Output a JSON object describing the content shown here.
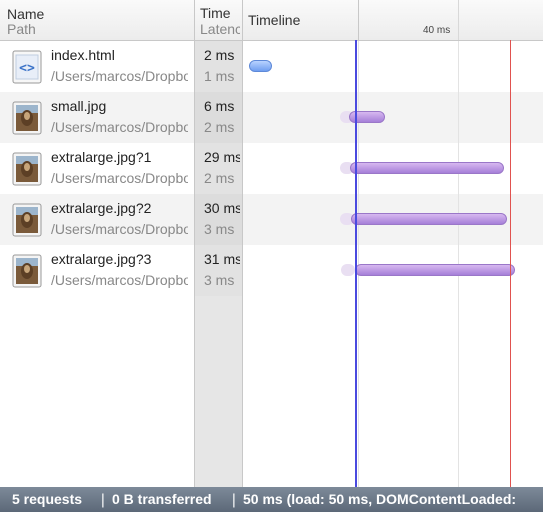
{
  "header": {
    "name_label": "Name",
    "path_label": "Path",
    "time_label": "Time",
    "latency_label": "Latency",
    "timeline_label": "Timeline",
    "tick_label": "40 ms"
  },
  "rows": [
    {
      "name": "index.html",
      "path": "/Users/marcos/Dropbox",
      "time": "2 ms",
      "latency": "1 ms",
      "icon": "html-file-icon"
    },
    {
      "name": "small.jpg",
      "path": "/Users/marcos/Dropbox",
      "time": "6 ms",
      "latency": "2 ms",
      "icon": "image-file-icon"
    },
    {
      "name": "extralarge.jpg?1",
      "path": "/Users/marcos/Dropbox",
      "time": "29 ms",
      "latency": "2 ms",
      "icon": "image-file-icon"
    },
    {
      "name": "extralarge.jpg?2",
      "path": "/Users/marcos/Dropbox",
      "time": "30 ms",
      "latency": "3 ms",
      "icon": "image-file-icon"
    },
    {
      "name": "extralarge.jpg?3",
      "path": "/Users/marcos/Dropbox",
      "time": "31 ms",
      "latency": "3 ms",
      "icon": "image-file-icon"
    }
  ],
  "status": {
    "requests": "5 requests",
    "sep1": "❘",
    "transferred": "0 B transferred",
    "sep2": "❘",
    "timing": "50 ms (load: 50 ms, DOMContentLoaded:"
  },
  "colors": {
    "dom_content_loaded_marker": "#4a4adf",
    "load_marker": "#e0524f",
    "image_bar": "#a67fd8",
    "document_bar": "#6f9ef0"
  }
}
